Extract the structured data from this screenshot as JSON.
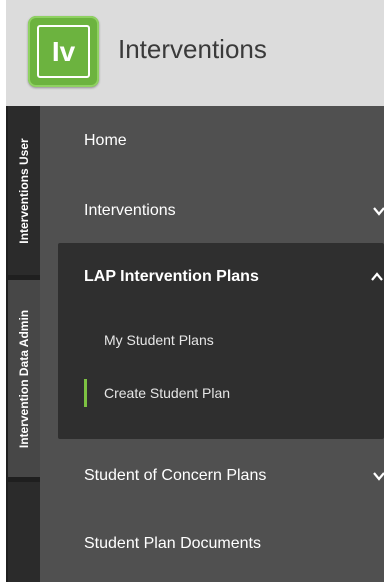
{
  "header": {
    "logo_text": "Iv",
    "app_title": "Interventions",
    "brand_color": "#6cb33f"
  },
  "rail": {
    "tabs": [
      {
        "label": "Interventions User"
      },
      {
        "label": "Intervention Data Admin",
        "active": true
      },
      {
        "label": ""
      }
    ]
  },
  "menu": {
    "items": [
      {
        "label": "Home"
      },
      {
        "label": "Interventions",
        "icon": "chevron-down-icon"
      },
      {
        "label": "LAP Intervention Plans",
        "expanded": true,
        "icon": "chevron-up-icon",
        "children": [
          {
            "label": "My Student Plans"
          },
          {
            "label": "Create Student Plan",
            "active": true
          }
        ]
      },
      {
        "label": "Student of Concern Plans",
        "icon": "chevron-down-icon"
      },
      {
        "label": "Student Plan Documents"
      }
    ],
    "active_indicator_color": "#7dc242"
  }
}
